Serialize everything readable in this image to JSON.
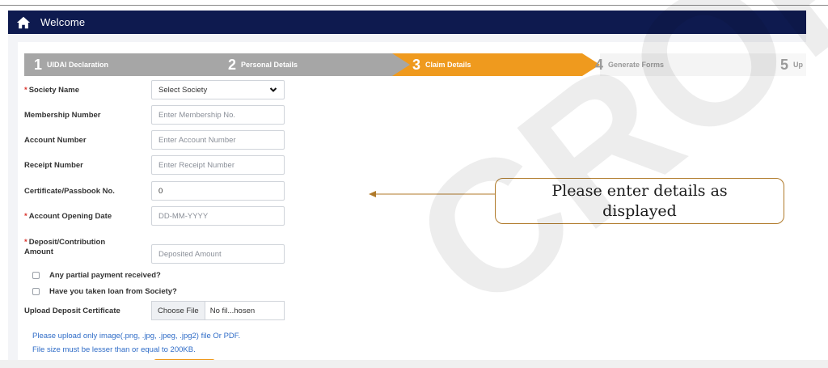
{
  "header": {
    "title": "Welcome",
    "home_icon": "home-icon",
    "bg_color": "#0e1a4f"
  },
  "stepper": {
    "steps": [
      {
        "num": "1",
        "label": "UIDAI Declaration"
      },
      {
        "num": "2",
        "label": "Personal Details"
      },
      {
        "num": "3",
        "label": "Claim Details"
      },
      {
        "num": "4",
        "label": "Generate Forms"
      },
      {
        "num": "5",
        "label": "Up"
      }
    ],
    "active_step": 3,
    "active_color": "#ef9a1e",
    "done_color": "#a6a6a6"
  },
  "form": {
    "society_name": {
      "label": "Society Name",
      "required": "*",
      "value": "Select Society"
    },
    "membership_number": {
      "label": "Membership Number",
      "placeholder": "Enter Membership No."
    },
    "account_number": {
      "label": "Account Number",
      "placeholder": "Enter Account Number"
    },
    "receipt_number": {
      "label": "Receipt Number",
      "placeholder": "Enter Receipt Number"
    },
    "certificate_no": {
      "label": "Certificate/Passbook No.",
      "value": "0"
    },
    "account_opening_date": {
      "label": "Account Opening Date",
      "required": "*",
      "placeholder": "DD-MM-YYYY"
    },
    "deposit_amount": {
      "label_line1": "Deposit/Contribution",
      "label_line2": "Amount",
      "required": "*",
      "placeholder": "Deposited Amount"
    },
    "partial_payment": {
      "label": "Any partial payment received?"
    },
    "loan_taken": {
      "label": "Have you taken loan from Society?"
    },
    "upload": {
      "label": "Upload Deposit Certificate",
      "button": "Choose File",
      "file_name": "No fil...hosen"
    },
    "note_line1": "Please upload only image(.png, .jpg, .jpeg, .jpg2) file Or PDF.",
    "note_line2": "File size must be lesser than or equal to 200KB."
  },
  "callout": {
    "line1": "Please enter details as",
    "line2": "displayed"
  },
  "watermark": {
    "text": "CROP"
  }
}
